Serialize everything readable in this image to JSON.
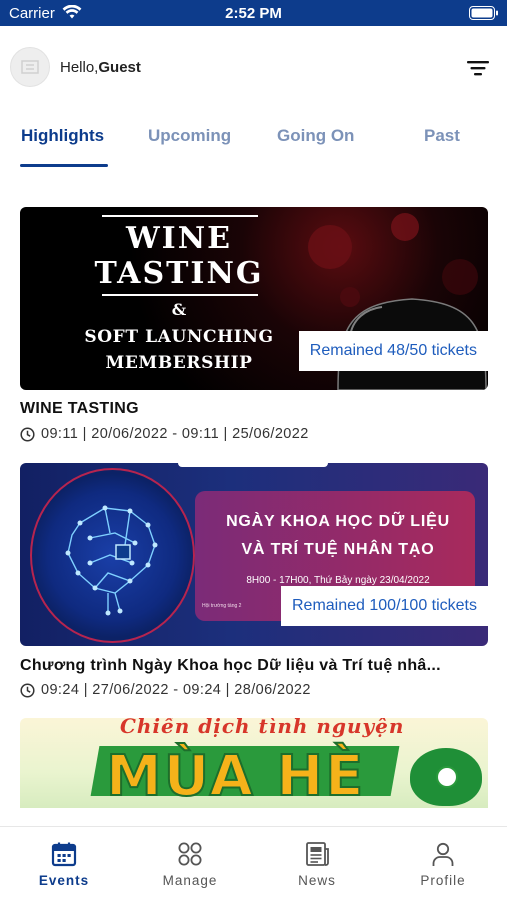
{
  "status_bar": {
    "carrier": "Carrier",
    "time": "2:52 PM",
    "icons": [
      "wifi-icon",
      "battery-icon"
    ]
  },
  "header": {
    "greeting_prefix": "Hello,",
    "user_name": "Guest",
    "avatar_icon": "avatar-icon",
    "filter_icon": "filter-icon"
  },
  "tabs": [
    {
      "label": "Highlights",
      "active": true
    },
    {
      "label": "Upcoming",
      "active": false
    },
    {
      "label": "Going On",
      "active": false
    },
    {
      "label": "Past",
      "active": false
    }
  ],
  "events": [
    {
      "title": "WINE TASTING",
      "time": "09:11 | 20/06/2022 - 09:11 | 25/06/2022",
      "tickets": "Remained 48/50 tickets",
      "banner": {
        "line1": "WINE",
        "line2": "TASTING",
        "amp": "&",
        "line3": "SOFT LAUNCHING",
        "line4": "MEMBERSHIP"
      }
    },
    {
      "title": "Chương trình Ngày Khoa học Dữ liệu và Trí tuệ nhâ...",
      "time": "09:24 | 27/06/2022 - 09:24 | 28/06/2022",
      "tickets": "Remained 100/100 tickets",
      "banner": {
        "line1": "NGÀY KHOA HỌC DỮ LIỆU",
        "line2": "VÀ TRÍ TUỆ NHÂN TẠO",
        "date": "8H00 - 17H00, Thứ Bảy ngày 23/04/2022",
        "venue": "Hội trường tầng 2"
      }
    },
    {
      "banner": {
        "script": "Chiến dịch tình nguyện",
        "word": "MÙA HÈ"
      }
    }
  ],
  "bottom_nav": [
    {
      "label": "Events",
      "icon": "calendar-icon",
      "active": true
    },
    {
      "label": "Manage",
      "icon": "grid-icon",
      "active": false
    },
    {
      "label": "News",
      "icon": "newspaper-icon",
      "active": false
    },
    {
      "label": "Profile",
      "icon": "person-icon",
      "active": false
    }
  ],
  "colors": {
    "primary": "#0d3c8c",
    "tab_inactive": "#7c92b8",
    "ticket_text": "#1f5dbd"
  }
}
